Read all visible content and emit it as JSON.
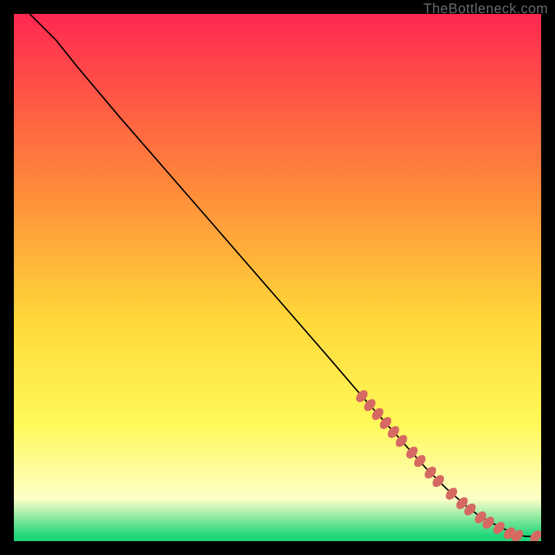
{
  "watermark": "TheBottleneck.com",
  "colors": {
    "gradient_top": "#ff2850",
    "gradient_mid_upper": "#ff8a3a",
    "gradient_mid": "#ffd83a",
    "gradient_mid_lower": "#fff95a",
    "gradient_pale": "#fdffc8",
    "gradient_green": "#1fd67a",
    "curve": "#000000",
    "marker": "#d66a63",
    "background": "#000000"
  },
  "chart_data": {
    "type": "line",
    "title": "",
    "xlabel": "",
    "ylabel": "",
    "xlim": [
      0,
      100
    ],
    "ylim": [
      0,
      100
    ],
    "series": [
      {
        "name": "curve",
        "x": [
          3,
          5,
          8,
          12,
          20,
          30,
          40,
          50,
          60,
          66,
          70,
          74,
          78,
          82,
          86,
          88,
          90,
          92,
          94,
          95.5,
          97,
          99
        ],
        "y": [
          100,
          98,
          95,
          90,
          80.5,
          69,
          57.5,
          46,
          34.5,
          27.5,
          23,
          18.5,
          14,
          10,
          6.5,
          5,
          3.8,
          2.8,
          1.8,
          1.2,
          0.9,
          0.9
        ]
      }
    ],
    "markers": {
      "name": "highlight-points",
      "color": "#d66a63",
      "points": [
        {
          "x": 66,
          "y": 27.5,
          "r": 1.1
        },
        {
          "x": 67.5,
          "y": 25.8,
          "r": 1.1
        },
        {
          "x": 69,
          "y": 24.1,
          "r": 1.1
        },
        {
          "x": 70.5,
          "y": 22.4,
          "r": 1.1
        },
        {
          "x": 72,
          "y": 20.7,
          "r": 1.1
        },
        {
          "x": 73.5,
          "y": 19.0,
          "r": 1.1
        },
        {
          "x": 75.5,
          "y": 16.8,
          "r": 1.1
        },
        {
          "x": 77,
          "y": 15.2,
          "r": 1.1
        },
        {
          "x": 79,
          "y": 13.0,
          "r": 1.1
        },
        {
          "x": 80.5,
          "y": 11.4,
          "r": 1.1
        },
        {
          "x": 83,
          "y": 9.0,
          "r": 1.1
        },
        {
          "x": 85,
          "y": 7.2,
          "r": 1.1
        },
        {
          "x": 86.5,
          "y": 6.0,
          "r": 1.1
        },
        {
          "x": 88.5,
          "y": 4.5,
          "r": 1.1
        },
        {
          "x": 90,
          "y": 3.5,
          "r": 1.1
        },
        {
          "x": 92,
          "y": 2.5,
          "r": 1.1
        },
        {
          "x": 94,
          "y": 1.5,
          "r": 1.1
        },
        {
          "x": 95.5,
          "y": 1.0,
          "r": 1.1
        },
        {
          "x": 99,
          "y": 0.9,
          "r": 1.1
        }
      ]
    }
  }
}
